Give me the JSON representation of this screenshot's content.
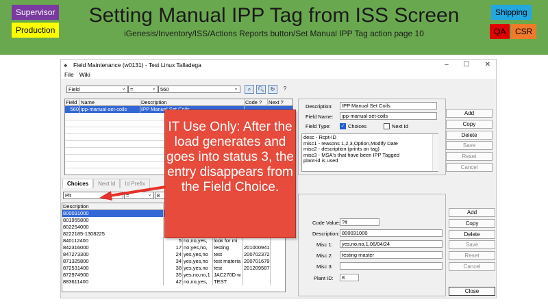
{
  "header": {
    "title": "Setting Manual IPP Tag from ISS Screen",
    "subtitle": "iGenesis/Inventory/ISS/Actions Reports button/Set Manual IPP Tag action page 10",
    "tags": {
      "supervisor": "Supervisor",
      "production": "Production",
      "shipping": "Shipping",
      "qa": "QA",
      "csr": "CSR"
    }
  },
  "window": {
    "title": "Field Maintenance (w0131) - Test Linux Talladega",
    "controls": {
      "minimize": "–",
      "maximize": "☐",
      "close": "✕"
    },
    "menu": [
      "File",
      "Wiki"
    ]
  },
  "filter": {
    "field": "Field",
    "operator": "=",
    "value": "560"
  },
  "field_grid": {
    "headers": [
      "Field",
      "Name",
      "Description",
      "Code ?",
      "Next ?"
    ],
    "rows": [
      {
        "field": "560",
        "name": "ipp-manual-set-coils",
        "description": "IPP Manual Set Coils"
      }
    ]
  },
  "detail": {
    "description_label": "Description:",
    "description_value": "IPP Manual Set Coils",
    "field_name_label": "Field Name:",
    "field_name_value": "ipp-manual-set-coils",
    "field_type_label": "Field Type:",
    "choices_label": "Choices",
    "next_id_label": "Next Id",
    "memo": "desc - Rcpt-ID\nmisc1 - reasons 1,2,3,Option,Modify Date\nmisc2 - description (prints on tag)\nmisc3 - MSA's that have been IPP Tagged\nplant-id is used"
  },
  "right_buttons": [
    "Add",
    "Copy",
    "Delete",
    "Save",
    "Reset",
    "Cancel"
  ],
  "tabs": [
    "Choices",
    "Next Id",
    "Id Prefix"
  ],
  "choice_filter": {
    "field": "Plt",
    "operator": "=",
    "value": "8"
  },
  "choice_grid": {
    "header": "Description",
    "rows": [
      {
        "desc": "800031000",
        "num": "",
        "misc1": "",
        "misc2": "",
        "date": ""
      },
      {
        "desc": "801955800",
        "num": "",
        "misc1": "",
        "misc2": "",
        "date": ""
      },
      {
        "desc": "802254000",
        "num": "",
        "misc1": "",
        "misc2": "",
        "date": ""
      },
      {
        "desc": "8222185-1308225",
        "num": "",
        "misc1": "",
        "misc2": "",
        "date": ""
      },
      {
        "desc": "840112400",
        "num": "5",
        "misc1": "no,no,yes,",
        "misc2": "look for mi",
        "date": ""
      },
      {
        "desc": "842316000",
        "num": "17",
        "misc1": "no,yes,no,",
        "misc2": "testing",
        "date": "201000941"
      },
      {
        "desc": "847273300",
        "num": "24",
        "misc1": "yes,yes,no",
        "misc2": "test",
        "date": "200702372"
      },
      {
        "desc": "871325800",
        "num": "34",
        "misc1": "yes,yes,no",
        "misc2": "test materia",
        "date": "200701679"
      },
      {
        "desc": "872531400",
        "num": "38",
        "misc1": "yes,yes,no",
        "misc2": "test",
        "date": "201209587"
      },
      {
        "desc": "872974900",
        "num": "35",
        "misc1": "yes,no,no,1",
        "misc2": "JAC270D w",
        "date": ""
      },
      {
        "desc": "883611400",
        "num": "42",
        "misc1": "no,no,yes,",
        "misc2": "TEST",
        "date": ""
      }
    ]
  },
  "choice_detail": {
    "code_label": "Code Value:",
    "code_value": "?¢",
    "desc_label": "Description:",
    "desc_value": "800031000",
    "misc1_label": "Misc 1:",
    "misc1_value": "yes,no,no,1,06/04/24",
    "misc2_label": "Misc 2:",
    "misc2_value": "testing master",
    "misc3_label": "Misc 3:",
    "misc3_value": "",
    "plant_label": "Plant ID:",
    "plant_value": "8"
  },
  "choice_buttons": [
    "Add",
    "Copy",
    "Delete",
    "Save",
    "Reset",
    "Cancel"
  ],
  "close_label": "Close",
  "callout": "IT Use Only: After the load generates and goes into status 3, the entry disappears from the Field Choice.",
  "colors": {
    "header_bg": "#6aa84f",
    "callout_bg": "#e74b3c",
    "selection": "#3367d6"
  }
}
